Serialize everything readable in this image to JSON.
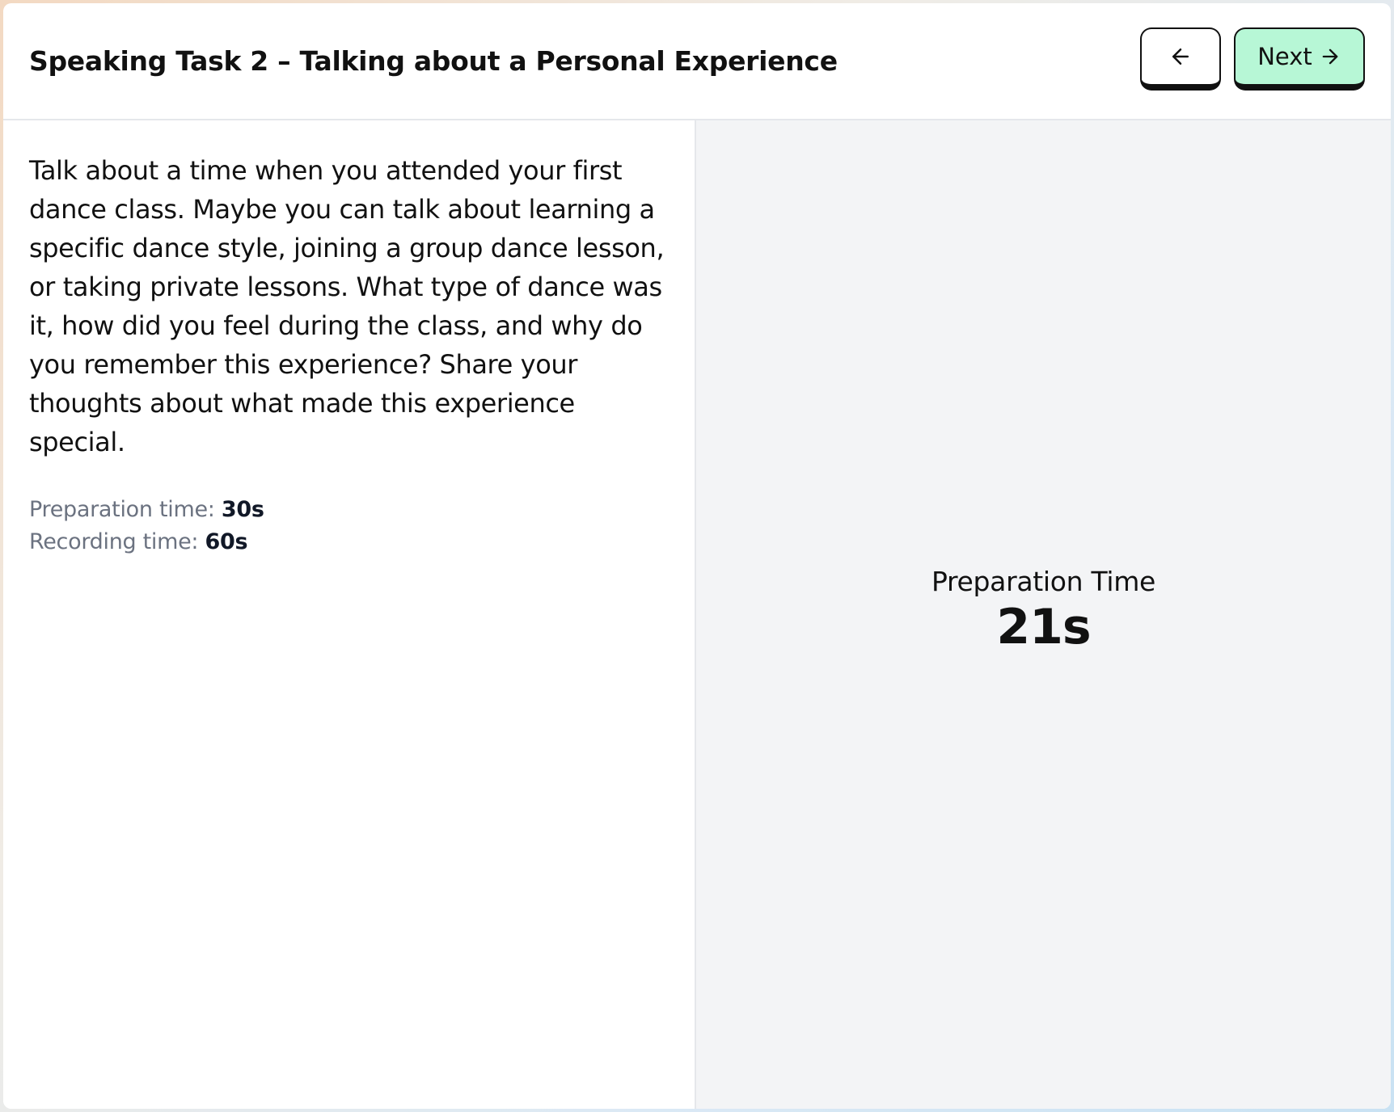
{
  "header": {
    "title": "Speaking Task 2 – Talking about a Personal Experience",
    "back_icon": "arrow-left-icon",
    "next_label": "Next",
    "next_icon": "arrow-right-icon"
  },
  "task": {
    "prompt": "Talk about a time when you attended your first dance class. Maybe you can talk about learning a specific dance style, joining a group dance lesson, or taking private lessons. What type of dance was it, how did you feel during the class, and why do you remember this experience? Share your thoughts about what made this experience special.",
    "preparation_label": "Preparation time:",
    "preparation_value": "30s",
    "recording_label": "Recording time:",
    "recording_value": "60s"
  },
  "timer": {
    "label": "Preparation Time",
    "value": "21s"
  },
  "colors": {
    "next_button_bg": "#b7f7d6",
    "right_pane_bg": "#f3f4f6",
    "meta_label": "#6b7280"
  }
}
